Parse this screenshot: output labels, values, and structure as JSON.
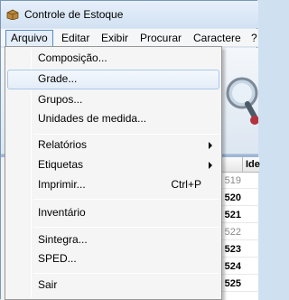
{
  "window": {
    "title": "Controle de Estoque"
  },
  "menubar": {
    "items": [
      {
        "label": "Arquivo",
        "open": true
      },
      {
        "label": "Editar"
      },
      {
        "label": "Exibir"
      },
      {
        "label": "Procurar"
      },
      {
        "label": "Caractere"
      },
      {
        "label": "?"
      }
    ]
  },
  "dropdown": {
    "items": [
      {
        "label": "Composição..."
      },
      {
        "label": "Grade...",
        "highlighted": true
      },
      {
        "label": "Grupos..."
      },
      {
        "label": "Unidades de medida..."
      },
      {
        "label": "Relatórios",
        "submenu": true
      },
      {
        "label": "Etiquetas",
        "submenu": true
      },
      {
        "label": "Imprimir...",
        "shortcut": "Ctrl+P"
      },
      {
        "label": "Inventário"
      },
      {
        "label": "Sintegra..."
      },
      {
        "label": "SPED..."
      },
      {
        "label": "Sair"
      }
    ]
  },
  "grid": {
    "header": "Ide",
    "rows": [
      "519",
      "520",
      "521",
      "522",
      "523",
      "524",
      "525"
    ]
  },
  "colors": {
    "titlebar": "#dbe7f5",
    "highlight_border": "#a8c8ec",
    "open_menu_border": "#5a8cc6"
  }
}
